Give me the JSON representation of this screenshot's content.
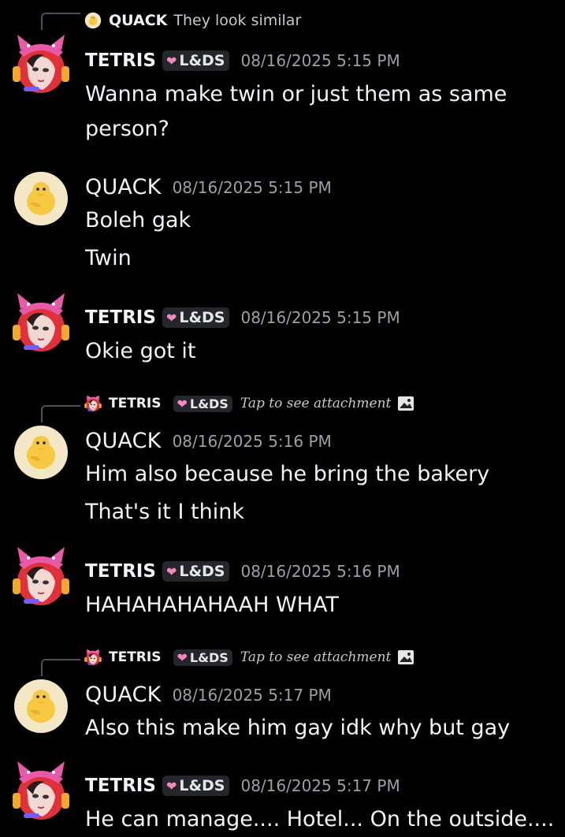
{
  "colors": {
    "background": "#000000",
    "text": "#f2f3f5",
    "timestamp": "#9aa0a8",
    "tag_bg": "#25262b",
    "heart": "#f487c0"
  },
  "messages": [
    {
      "reply": {
        "author": "QUACK",
        "text": "They look similar",
        "icon": "duck-avatar-icon"
      },
      "author": "TETRIS",
      "tag": "L&DS",
      "timestamp": "08/16/2025 5:15 PM",
      "lines": [
        "Wanna make twin or just them as same",
        "person?"
      ]
    },
    {
      "author": "QUACK",
      "timestamp": "08/16/2025 5:15 PM",
      "lines": [
        "Boleh gak",
        "Twin"
      ]
    },
    {
      "author": "TETRIS",
      "tag": "L&DS",
      "timestamp": "08/16/2025 5:15 PM",
      "lines": [
        "Okie  got it"
      ]
    },
    {
      "reply": {
        "author": "TETRIS",
        "tag": "L&DS",
        "text": "Tap to see attachment",
        "icon": "image-icon"
      },
      "author": "QUACK",
      "timestamp": "08/16/2025 5:16 PM",
      "lines": [
        "Him also because he bring the bakery",
        "That's it I think"
      ]
    },
    {
      "author": "TETRIS",
      "tag": "L&DS",
      "timestamp": "08/16/2025 5:16 PM",
      "lines": [
        "HAHAHAHAHAAH WHAT"
      ]
    },
    {
      "reply": {
        "author": "TETRIS",
        "tag": "L&DS",
        "text": "Tap to see attachment",
        "icon": "image-icon"
      },
      "author": "QUACK",
      "timestamp": "08/16/2025 5:17 PM",
      "lines": [
        "Also this make him gay idk why but gay"
      ]
    },
    {
      "author": "TETRIS",
      "tag": "L&DS",
      "timestamp": "08/16/2025 5:17 PM",
      "lines": [
        "He can manage.... Hotel... On the outside...."
      ]
    }
  ]
}
